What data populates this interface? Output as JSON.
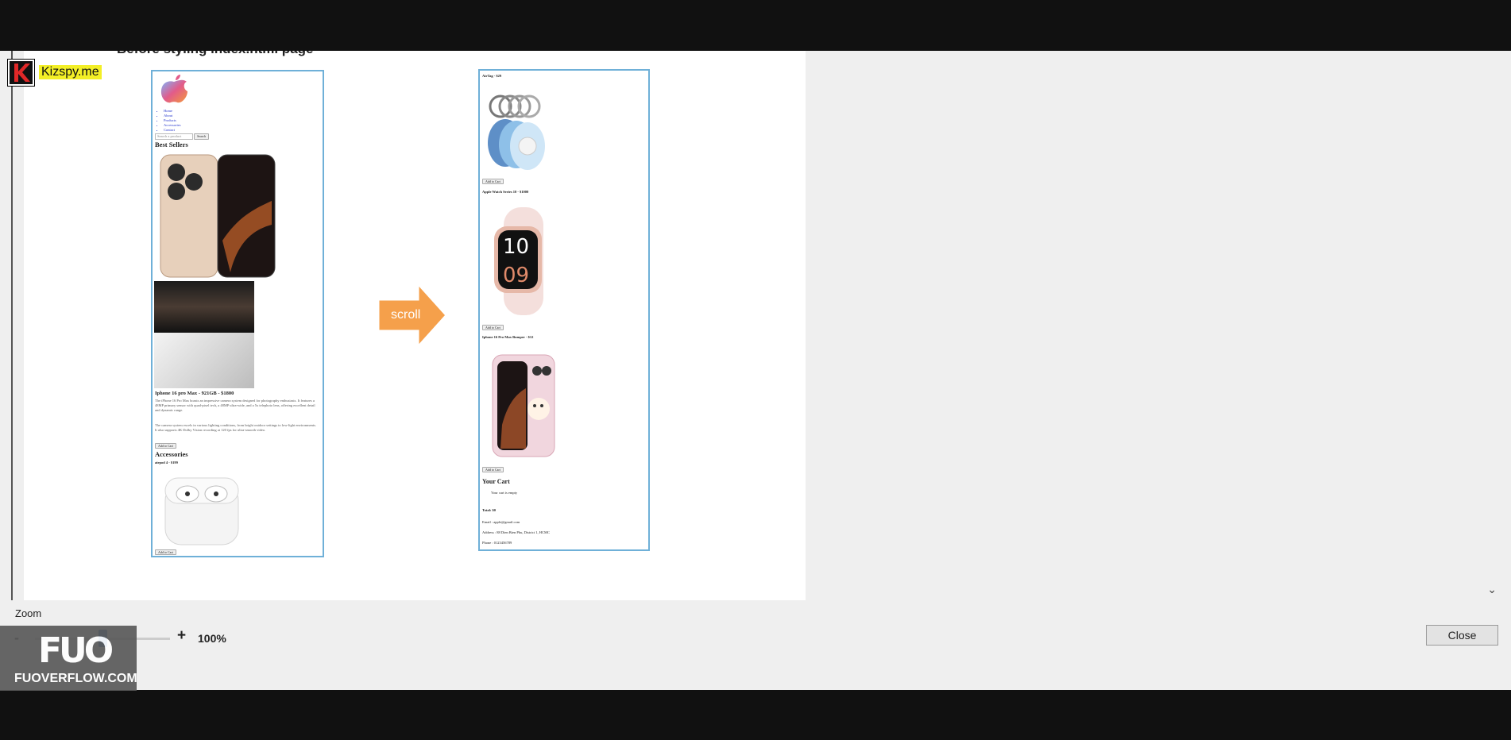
{
  "document": {
    "heading": "Before styling index.html page"
  },
  "page1": {
    "nav_items": [
      "Home",
      "About",
      "Products",
      "Accessories",
      "Contact"
    ],
    "search_placeholder": "Search a product",
    "search_button": "Search",
    "best_sellers_title": "Best Sellers",
    "product_title": "Iphone 16 pro Max - 921GB - $1800",
    "paragraph1": "The iPhone 16 Pro Max boasts an impressive camera system designed for photography enthusiasts. It features a 48MP primary sensor with quad-pixel tech, a 48MP ultra-wide, and a 5x telephoto lens, offering excellent detail and dynamic range.",
    "paragraph2": "The camera system excels in various lighting conditions, from bright outdoor settings to low-light environments. It also supports 4K Dolby Vision recording at 120 fps for ultra-smooth video.",
    "add_button": "Add to Cart",
    "accessories_title": "Accessories",
    "airpod_title": "airpod 4 - $199",
    "airpod_button": "Add to Cart"
  },
  "page2": {
    "airtag_title": "AirTag - $29",
    "airtag_button": "Add to Cart",
    "watch_title": "Apple Watch Series 10 - $1000",
    "watch_button": "Add to Cart",
    "case_title": "Iphone 16 Pro Max Bumper - $12",
    "case_button": "Add to Cart",
    "cart_title": "Your Cart",
    "cart_empty": "Your cart is empty",
    "total": "Total: $0",
    "email": "Email : apple@gmail.com",
    "address": "Address : 88 Dien Bien Phu, District 1, HCMC",
    "phone": "Phone : 0123456789"
  },
  "arrow_label": "scroll",
  "zoom": {
    "label": "Zoom",
    "minus": "-",
    "plus": "+",
    "value": "100%",
    "level_percent": 100
  },
  "close_button": "Close",
  "watermarks": {
    "kizspy": "Kizspy.me",
    "fuo_big": "FUO",
    "fuo_small": "FUOVERFLOW.COM"
  },
  "colors": {
    "accent_blue": "#1f5fa8",
    "page_border": "#6fb0d8",
    "arrow_orange": "#f5a04b",
    "kizspy_yellow": "#f3ef26"
  }
}
